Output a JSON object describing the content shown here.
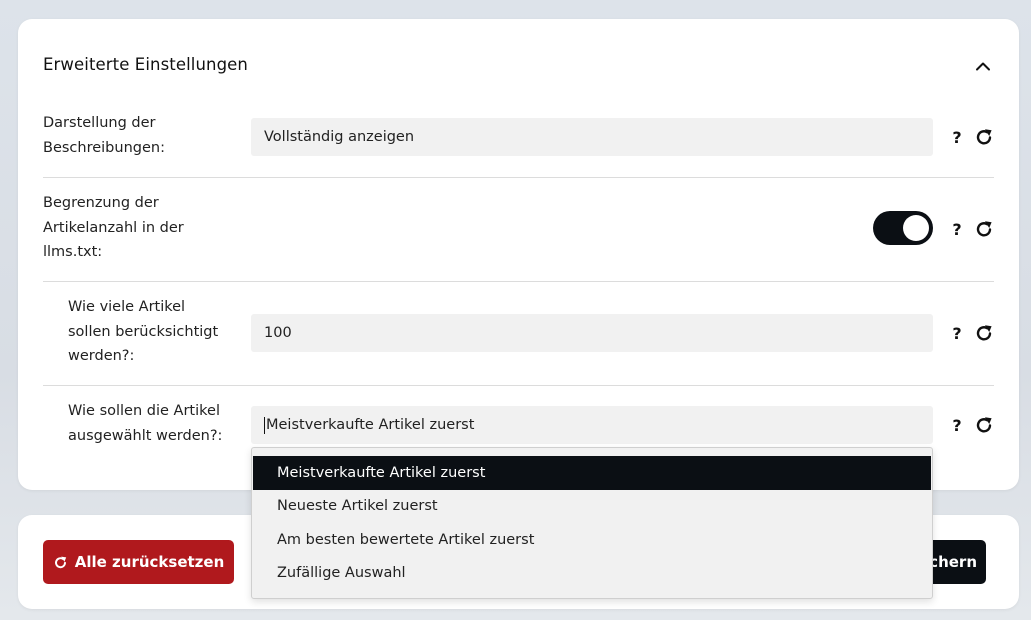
{
  "section": {
    "title": "Erweiterte Einstellungen"
  },
  "rows": {
    "description": {
      "label_lines": [
        "Darstellung der",
        "Beschreibungen:"
      ],
      "value": "Vollständig anzeigen"
    },
    "limit": {
      "label_lines": [
        "Begrenzung der",
        "Artikelanzahl in der",
        "llms.txt:"
      ],
      "toggle_on": true
    },
    "count": {
      "label_lines": [
        "Wie viele Artikel",
        "sollen berücksichtigt",
        "werden?:"
      ],
      "value": "100"
    },
    "selection": {
      "label_lines": [
        "Wie sollen die Artikel",
        "ausgewählt werden?:"
      ],
      "value": "Meistverkaufte Artikel zuerst"
    }
  },
  "help_symbol": "?",
  "dropdown": {
    "options": [
      "Meistverkaufte Artikel zuerst",
      "Neueste Artikel zuerst",
      "Am besten bewertete Artikel zuerst",
      "Zufällige Auswahl"
    ],
    "selected_index": 0
  },
  "footer": {
    "reset_all_label": "Alle zurücksetzen",
    "save_label_visible": "chern"
  },
  "colors": {
    "danger": "#b0191d",
    "dark": "#0b0f14",
    "field_bg": "#f1f1f1"
  },
  "icons": {
    "collapse": "chevron-up-icon",
    "reset": "refresh-icon",
    "help": "question-icon"
  }
}
